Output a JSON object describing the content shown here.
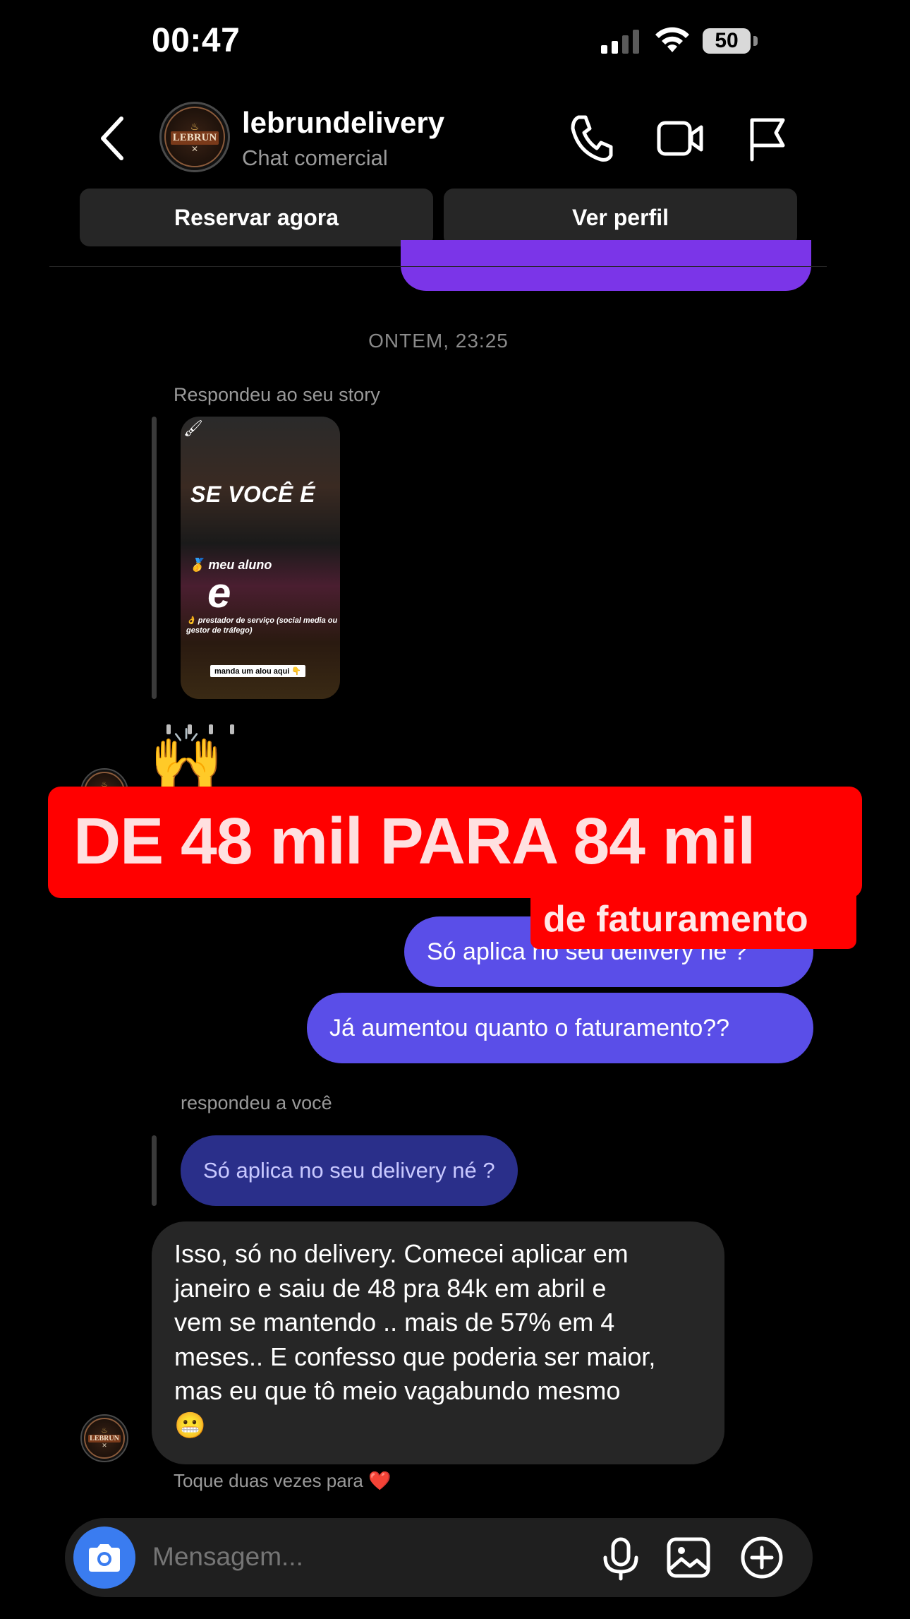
{
  "status_bar": {
    "time": "00:47",
    "battery": "50"
  },
  "header": {
    "username": "lebrundelivery",
    "subtitle": "Chat comercial",
    "avatar_logo": "LEBRUN"
  },
  "actions": {
    "reserve_label": "Reservar agora",
    "profile_label": "Ver perfil"
  },
  "chat": {
    "date_separator": "ONTEM, 23:25",
    "story_reply_label": "Respondeu ao seu story",
    "story": {
      "headline": "SE VOCÊ É",
      "line1": "🥇 meu aluno",
      "connector": "e",
      "line2": "👌 prestador de serviço (social media ou gestor de tráfego)",
      "cta": "manda um alou aqui 👇"
    },
    "reaction_emoji": "🙌",
    "banner_main": "DE 48 mil PARA 84 mil",
    "banner_sub": "de faturamento",
    "outgoing": [
      "Só aplica no seu delivery né ?",
      "Já aumentou quanto o faturamento??"
    ],
    "reply_to_you_label": "respondeu a você",
    "quoted_message": "Só aplica no seu delivery né ?",
    "incoming_lines": [
      "Isso, só no delivery. Comecei aplicar em",
      "janeiro e saiu de 48 pra 84k em abril e",
      "vem se mantendo .. mais de 57% em 4",
      "meses.. E confesso que poderia ser maior,",
      "mas eu que tô meio vagabundo mesmo",
      "😬"
    ],
    "double_tap_hint": "Toque duas vezes para ❤️"
  },
  "composer": {
    "placeholder": "Mensagem..."
  },
  "colors": {
    "outgoing_bubble": "#5a4ee8",
    "incoming_bubble": "#262626",
    "banner_red": "#ff0000",
    "camera_button": "#3a7cf0"
  },
  "icons": [
    "back-icon",
    "phone-icon",
    "video-icon",
    "flag-icon",
    "camera-icon",
    "microphone-icon",
    "gallery-icon",
    "plus-icon"
  ]
}
